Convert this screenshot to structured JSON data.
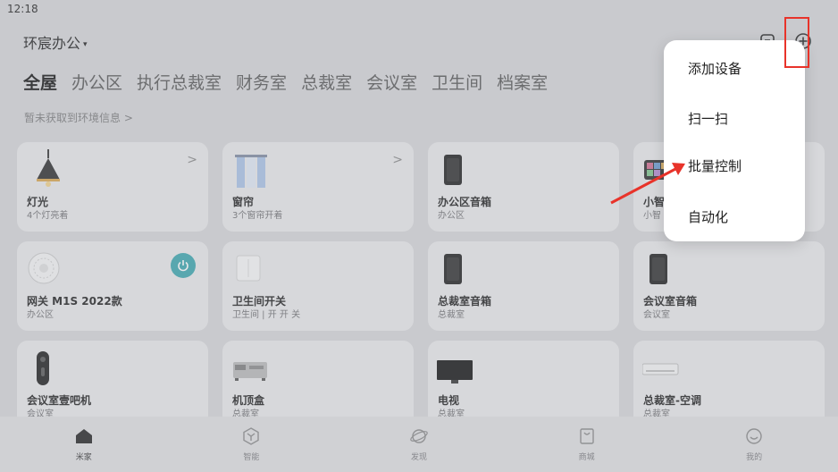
{
  "status_bar": {
    "time": "12:18"
  },
  "header": {
    "home_name": "环宸办公",
    "caret": "▾"
  },
  "rooms": [
    "全屋",
    "办公区",
    "执行总裁室",
    "财务室",
    "总裁室",
    "会议室",
    "卫生间",
    "档案室"
  ],
  "environment_info": "暂未获取到环境信息 >",
  "devices": [
    {
      "name": "灯光",
      "sub": "4个灯亮着",
      "icon": "pendant-lamp-icon",
      "chevron": ">"
    },
    {
      "name": "窗帘",
      "sub": "3个窗帘开着",
      "icon": "curtain-icon",
      "chevron": ">"
    },
    {
      "name": "办公区音箱",
      "sub": "办公区",
      "icon": "speaker-icon"
    },
    {
      "name": "小智",
      "sub": "小智",
      "icon": "smart-panel-icon"
    },
    {
      "name": "网关 M1S 2022款",
      "sub": "办公区",
      "icon": "gateway-icon",
      "power": true
    },
    {
      "name": "卫生间开关",
      "sub": "卫生间 | 开 开 关",
      "icon": "wall-switch-icon"
    },
    {
      "name": "总裁室音箱",
      "sub": "总裁室",
      "icon": "speaker-icon"
    },
    {
      "name": "会议室音箱",
      "sub": "会议室",
      "icon": "speaker-icon"
    },
    {
      "name": "会议室壹吧机",
      "sub": "会议室",
      "icon": "remote-icon"
    },
    {
      "name": "机顶盒",
      "sub": "总裁室",
      "icon": "set-top-box-icon"
    },
    {
      "name": "电视",
      "sub": "总裁室",
      "icon": "tv-icon"
    },
    {
      "name": "总裁室-空调",
      "sub": "总裁室",
      "icon": "air-conditioner-icon"
    }
  ],
  "menu": {
    "items": [
      "添加设备",
      "扫一扫",
      "批量控制",
      "自动化"
    ]
  },
  "bottom_nav": [
    {
      "label": "米家",
      "icon": "home-icon",
      "active": true
    },
    {
      "label": "智能",
      "icon": "smart-icon"
    },
    {
      "label": "发现",
      "icon": "planet-icon"
    },
    {
      "label": "商城",
      "icon": "shop-bag-icon"
    },
    {
      "label": "我的",
      "icon": "profile-smile-icon"
    }
  ],
  "colors": {
    "power_accent": "#3aa6ad",
    "highlight_red": "#e8332a"
  }
}
